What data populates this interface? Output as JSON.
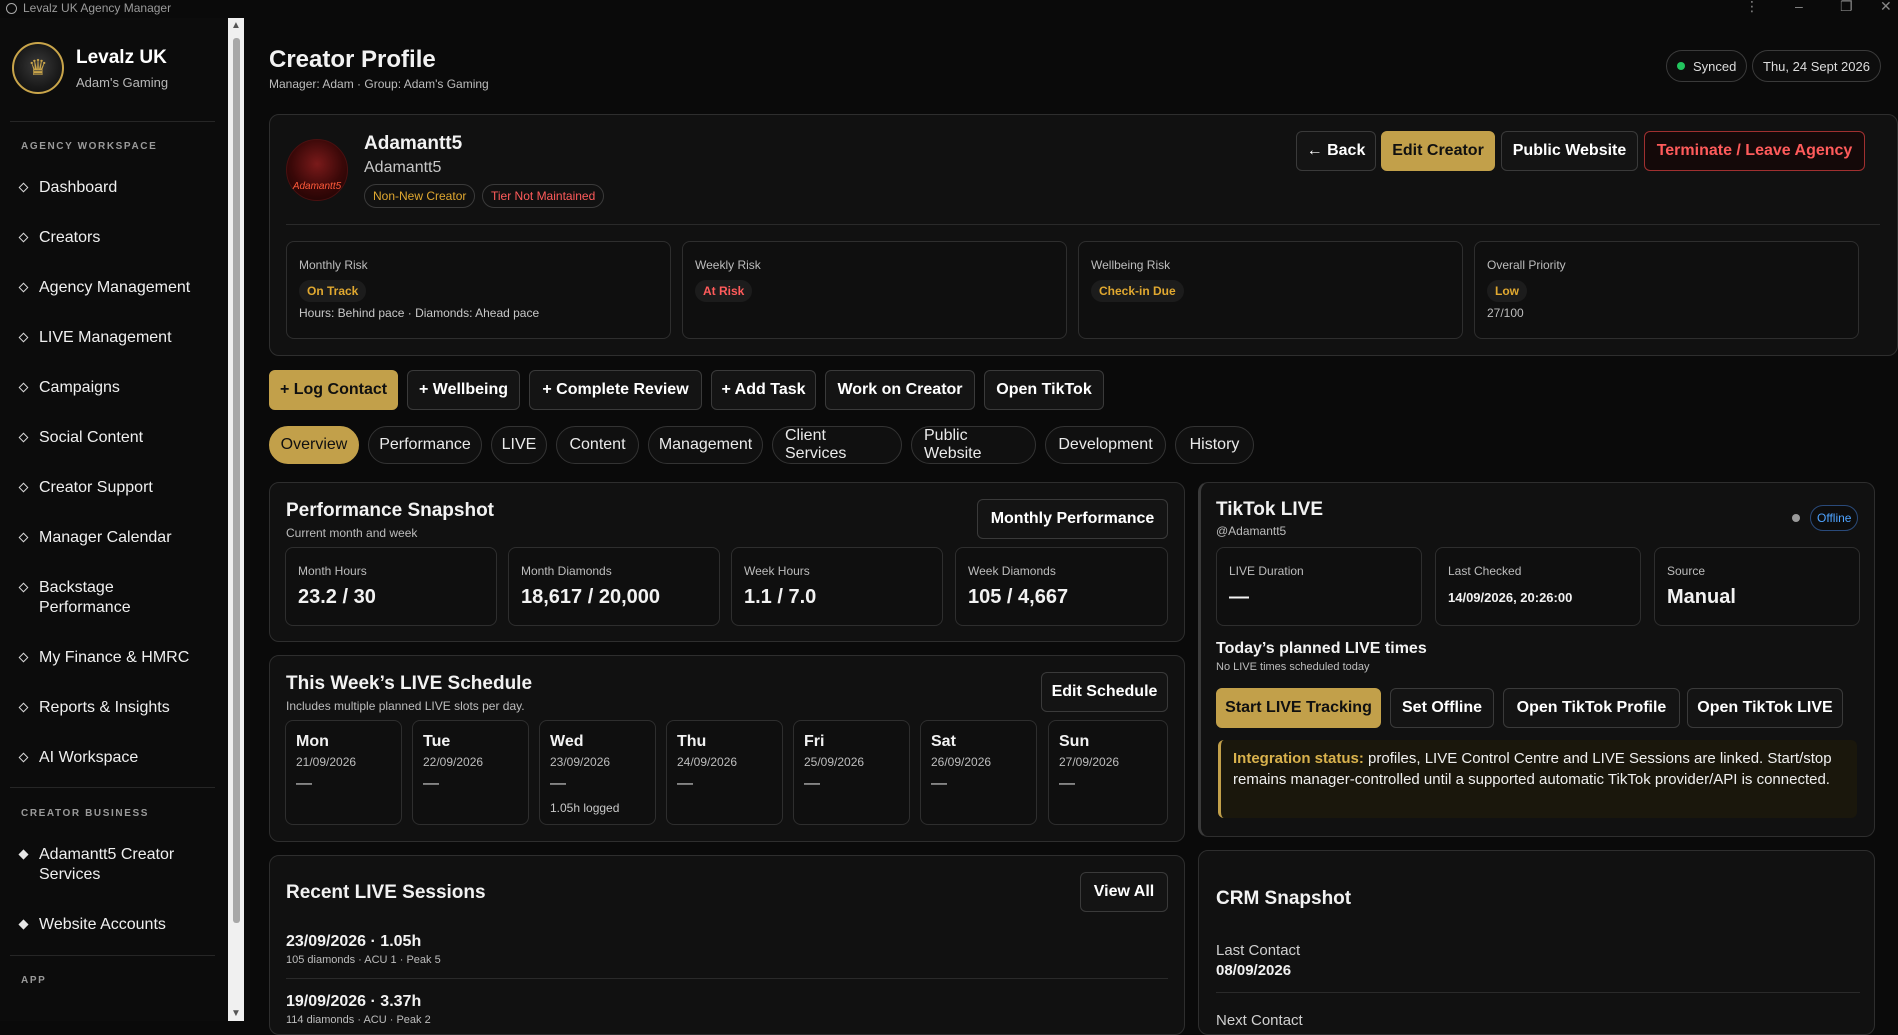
{
  "window": {
    "title": "Levalz UK Agency Manager"
  },
  "brand": {
    "name": "Levalz UK",
    "subtitle": "Adam's Gaming"
  },
  "sidebar": {
    "section_workspace": "AGENCY WORKSPACE",
    "items": [
      {
        "label": "Dashboard"
      },
      {
        "label": "Creators"
      },
      {
        "label": "Agency Management"
      },
      {
        "label": "LIVE Management"
      },
      {
        "label": "Campaigns"
      },
      {
        "label": "Social Content"
      },
      {
        "label": "Creator Support"
      },
      {
        "label": "Manager Calendar"
      },
      {
        "label": "Backstage Performance"
      },
      {
        "label": "My Finance & HMRC"
      },
      {
        "label": "Reports & Insights"
      },
      {
        "label": "AI Workspace"
      }
    ],
    "section_business": "CREATOR BUSINESS",
    "business_items": [
      {
        "label": "Adamantt5 Creator Services"
      },
      {
        "label": "Website Accounts"
      }
    ],
    "section_app": "APP"
  },
  "header": {
    "title": "Creator Profile",
    "subtitle": "Manager: Adam · Group: Adam's Gaming",
    "sync_status": "Synced",
    "date": "Thu, 24 Sept 2026"
  },
  "creator": {
    "name": "Adamantt5",
    "handle": "Adamantt5",
    "avatar_text": "Adamantt5",
    "tags": [
      "Non-New Creator",
      "Tier Not Maintained"
    ],
    "actions": {
      "back": "← Back",
      "edit": "Edit Creator",
      "website": "Public Website",
      "terminate": "Terminate / Leave Agency"
    }
  },
  "risks": [
    {
      "label": "Monthly Risk",
      "badge": "On Track",
      "color": "#e0a830",
      "note": "Hours: Behind pace · Diamonds: Ahead pace"
    },
    {
      "label": "Weekly Risk",
      "badge": "At Risk",
      "color": "#ff5b5b",
      "note": ""
    },
    {
      "label": "Wellbeing Risk",
      "badge": "Check-in Due",
      "color": "#e0a830",
      "note": ""
    },
    {
      "label": "Overall Priority",
      "badge": "Low",
      "color": "#e0a830",
      "note": "27/100"
    }
  ],
  "quick_actions": [
    "+ Log Contact",
    "+ Wellbeing",
    "+ Complete Review",
    "+ Add Task",
    "Work on Creator",
    "Open TikTok"
  ],
  "tabs": [
    "Overview",
    "Performance",
    "LIVE",
    "Content",
    "Management",
    "Client Services",
    "Public Website",
    "Development",
    "History"
  ],
  "performance": {
    "title": "Performance Snapshot",
    "subtitle": "Current month and week",
    "button": "Monthly Performance",
    "stats": [
      {
        "label": "Month Hours",
        "value": "23.2 / 30"
      },
      {
        "label": "Month Diamonds",
        "value": "18,617 / 20,000"
      },
      {
        "label": "Week Hours",
        "value": "1.1 / 7.0"
      },
      {
        "label": "Week Diamonds",
        "value": "105 / 4,667"
      }
    ]
  },
  "schedule": {
    "title": "This Week’s LIVE Schedule",
    "subtitle": "Includes multiple planned LIVE slots per day.",
    "button": "Edit Schedule",
    "days": [
      {
        "name": "Mon",
        "date": "21/09/2026",
        "dash": "—",
        "note": ""
      },
      {
        "name": "Tue",
        "date": "22/09/2026",
        "dash": "—",
        "note": ""
      },
      {
        "name": "Wed",
        "date": "23/09/2026",
        "dash": "—",
        "note": "1.05h logged"
      },
      {
        "name": "Thu",
        "date": "24/09/2026",
        "dash": "—",
        "note": ""
      },
      {
        "name": "Fri",
        "date": "25/09/2026",
        "dash": "—",
        "note": ""
      },
      {
        "name": "Sat",
        "date": "26/09/2026",
        "dash": "—",
        "note": ""
      },
      {
        "name": "Sun",
        "date": "27/09/2026",
        "dash": "—",
        "note": ""
      }
    ]
  },
  "sessions": {
    "title": "Recent LIVE Sessions",
    "button": "View All",
    "items": [
      {
        "title": "23/09/2026 · 1.05h",
        "sub": "105 diamonds · ACU 1 · Peak 5"
      },
      {
        "title": "19/09/2026 · 3.37h",
        "sub": "114 diamonds · ACU · Peak 2"
      }
    ]
  },
  "tiktok": {
    "title": "TikTok LIVE",
    "handle": "@Adamantt5",
    "status": "Offline",
    "stats": [
      {
        "label": "LIVE Duration",
        "value": "—"
      },
      {
        "label": "Last Checked",
        "value": "14/09/2026, 20:26:00"
      },
      {
        "label": "Source",
        "value": "Manual"
      }
    ],
    "planned_title": "Today’s planned LIVE times",
    "planned_sub": "No LIVE times scheduled today",
    "actions": [
      "Start LIVE Tracking",
      "Set Offline",
      "Open TikTok Profile",
      "Open TikTok LIVE"
    ],
    "integration_label": "Integration status:",
    "integration_text": " profiles, LIVE Control Centre and LIVE Sessions are linked. Start/stop remains manager-controlled until a supported automatic TikTok provider/API is connected."
  },
  "crm": {
    "title": "CRM Snapshot",
    "last_contact_label": "Last Contact",
    "last_contact_value": "08/09/2026",
    "next_contact_label": "Next Contact"
  },
  "colors": {
    "accent": "#c2a04a",
    "danger": "#ff5b5b",
    "synced": "#22c55e",
    "offline": "#4ea3ff"
  }
}
